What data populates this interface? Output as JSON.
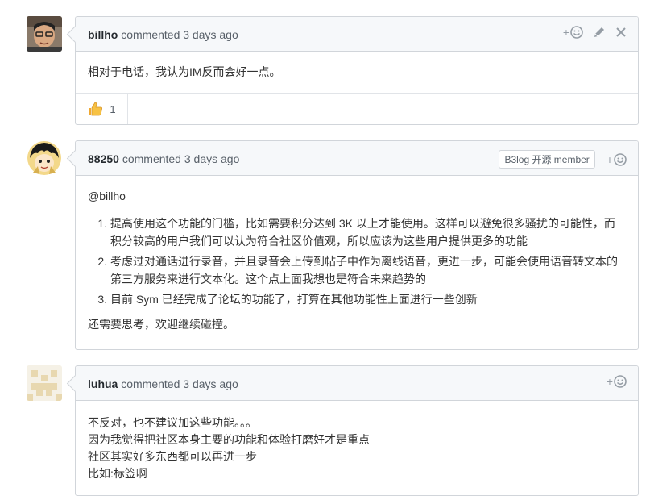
{
  "comments": [
    {
      "author": "billho",
      "meta": "commented 3 days ago",
      "body": "相对于电话，我认为IM反而会好一点。",
      "reactions": [
        {
          "icon": "thumbs-up-icon",
          "count": "1"
        }
      ]
    },
    {
      "author": "88250",
      "meta": "commented 3 days ago",
      "badge": "B3log 开源 member",
      "mention": "@billho",
      "list": [
        "提高使用这个功能的门槛，比如需要积分达到 3K 以上才能使用。这样可以避免很多骚扰的可能性，而积分较高的用户我们可以认为符合社区价值观，所以应该为这些用户提供更多的功能",
        "考虑过对通话进行录音，并且录音会上传到帖子中作为离线语音，更进一步，可能会使用语音转文本的第三方服务来进行文本化。这个点上面我想也是符合未来趋势的",
        "目前 Sym 已经完成了论坛的功能了，打算在其他功能性上面进行一些创新"
      ],
      "footer": "还需要思考，欢迎继续碰撞。"
    },
    {
      "author": "luhua",
      "meta": "commented 3 days ago",
      "lines": [
        "不反对，也不建议加这些功能。。。",
        "因为我觉得把社区本身主要的功能和体验打磨好才是重点",
        "社区其实好多东西都可以再进一步",
        "比如:标签啊"
      ]
    }
  ],
  "ui": {
    "plus": "+"
  }
}
